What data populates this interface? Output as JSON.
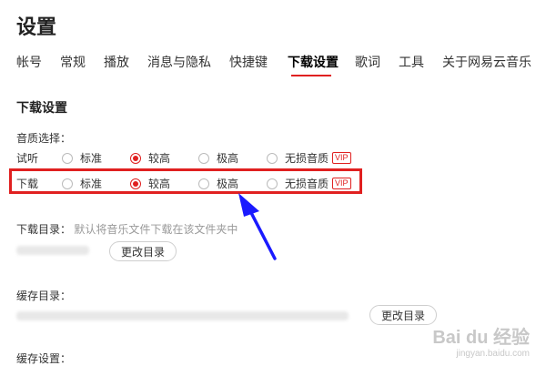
{
  "page": {
    "title": "设置"
  },
  "tabs": [
    {
      "label": "帐号"
    },
    {
      "label": "常规"
    },
    {
      "label": "播放"
    },
    {
      "label": "消息与隐私"
    },
    {
      "label": "快捷键"
    },
    {
      "label": "下载设置",
      "active": true
    },
    {
      "label": "歌词"
    },
    {
      "label": "工具"
    },
    {
      "label": "关于网易云音乐"
    }
  ],
  "download": {
    "section_title": "下载设置",
    "quality_label": "音质选择：",
    "preview": {
      "label": "试听",
      "options": [
        "标准",
        "较高",
        "极高",
        "无损音质"
      ],
      "selected": "较高",
      "vip": "VIP"
    },
    "download_row": {
      "label": "下载",
      "options": [
        "标准",
        "较高",
        "极高",
        "无损音质"
      ],
      "selected": "较高",
      "vip": "VIP"
    },
    "dir_label": "下载目录：",
    "dir_hint": "默认将音乐文件下载在该文件夹中",
    "change_button": "更改目录"
  },
  "cache": {
    "dir_label": "缓存目录：",
    "change_button": "更改目录",
    "settings_label": "缓存设置："
  },
  "watermark": {
    "brand": "Bai du 经验",
    "url": "jingyan.baidu.com"
  },
  "colors": {
    "accent": "#e02020",
    "annotation_arrow": "#1a1aff"
  }
}
